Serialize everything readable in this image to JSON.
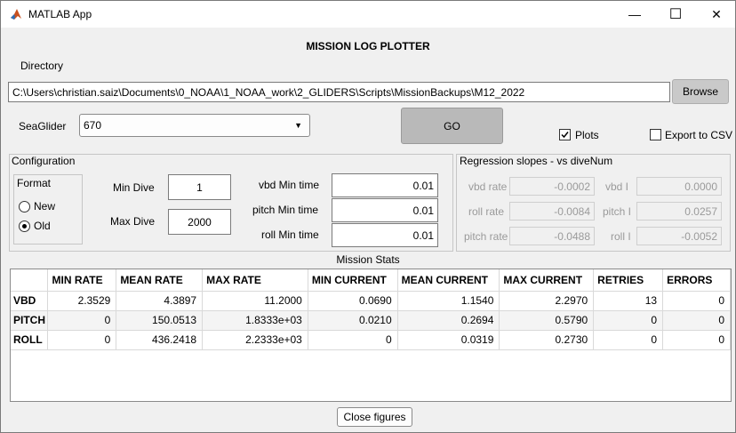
{
  "window": {
    "title": "MATLAB App",
    "minimize_glyph": "—",
    "maximize_glyph": "☐",
    "close_glyph": "✕"
  },
  "app_title": "MISSION LOG PLOTTER",
  "directory": {
    "label": "Directory",
    "value": "C:\\Users\\christian.saiz\\Documents\\0_NOAA\\1_NOAA_work\\2_GLIDERS\\Scripts\\MissionBackups\\M12_2022",
    "browse_label": "Browse"
  },
  "seaglider": {
    "label": "SeaGlider",
    "selected": "670"
  },
  "go_label": "GO",
  "plots": {
    "label": "Plots",
    "checked": true
  },
  "export_csv": {
    "label": "Export to CSV",
    "checked": false
  },
  "configuration": {
    "title": "Configuration",
    "format": {
      "title": "Format",
      "options": [
        {
          "label": "New",
          "selected": false
        },
        {
          "label": "Old",
          "selected": true
        }
      ]
    },
    "min_dive": {
      "label": "Min Dive",
      "value": "1"
    },
    "max_dive": {
      "label": "Max Dive",
      "value": "2000"
    },
    "vbd_min_time": {
      "label": "vbd Min time",
      "value": "0.01"
    },
    "pitch_min_time": {
      "label": "pitch Min time",
      "value": "0.01"
    },
    "roll_min_time": {
      "label": "roll Min time",
      "value": "0.01"
    }
  },
  "regression": {
    "title": "Regression slopes - vs diveNum",
    "vbd_rate": {
      "label": "vbd rate",
      "value": "-0.0002"
    },
    "roll_rate": {
      "label": "roll rate",
      "value": "-0.0084"
    },
    "pitch_rate": {
      "label": "pitch rate",
      "value": "-0.0488"
    },
    "vbd_i": {
      "label": "vbd I",
      "value": "0.0000"
    },
    "pitch_i": {
      "label": "pitch I",
      "value": "0.0257"
    },
    "roll_i": {
      "label": "roll I",
      "value": "-0.0052"
    }
  },
  "stats": {
    "title": "Mission Stats",
    "headers": [
      "",
      "MIN RATE",
      "MEAN RATE",
      "MAX RATE",
      "MIN CURRENT",
      "MEAN CURRENT",
      "MAX CURRENT",
      "RETRIES",
      "ERRORS"
    ],
    "rows": [
      [
        "VBD",
        "2.3529",
        "4.3897",
        "11.2000",
        "0.0690",
        "1.1540",
        "2.2970",
        "13",
        "0"
      ],
      [
        "PITCH",
        "0",
        "150.0513",
        "1.8333e+03",
        "0.0210",
        "0.2694",
        "0.5790",
        "0",
        "0"
      ],
      [
        "ROLL",
        "0",
        "436.2418",
        "2.2333e+03",
        "0",
        "0.0319",
        "0.2730",
        "0",
        "0"
      ]
    ]
  },
  "close_figures_label": "Close figures"
}
